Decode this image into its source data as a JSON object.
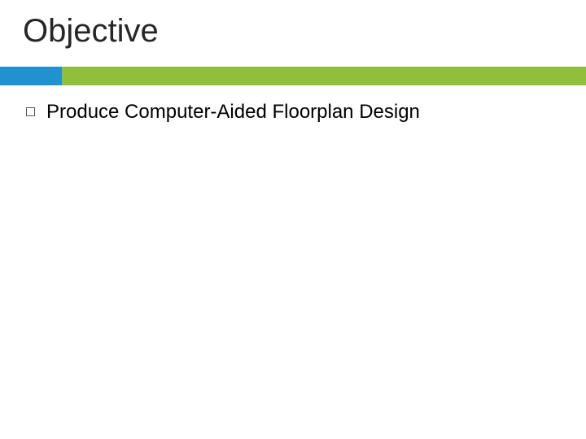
{
  "title": "Objective",
  "colors": {
    "accent_blue": "#1f92cf",
    "accent_green": "#8fc03c"
  },
  "bullets": [
    {
      "text": "Produce Computer-Aided Floorplan Design"
    }
  ]
}
